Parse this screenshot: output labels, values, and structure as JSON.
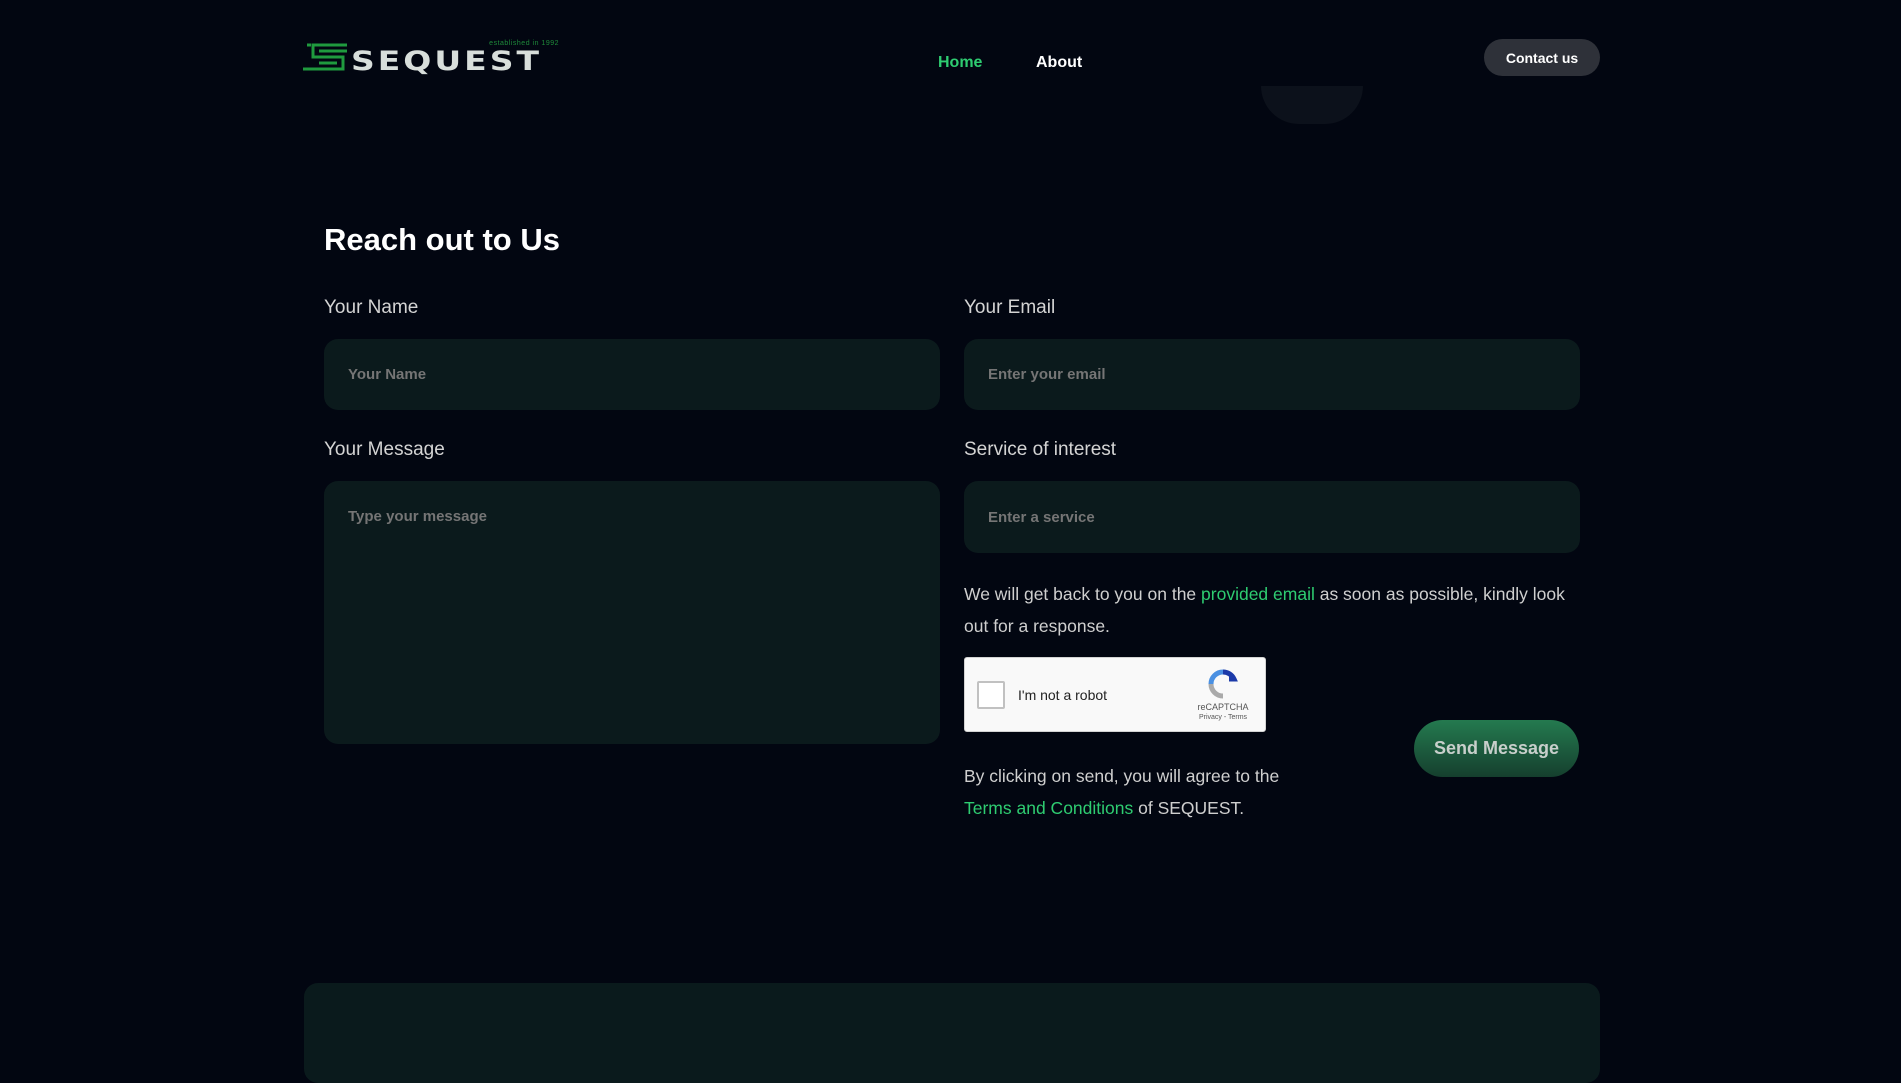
{
  "header": {
    "logo_text": "SEQUEST",
    "logo_tagline": "established in 1992",
    "nav": [
      {
        "label": "Home"
      },
      {
        "label": "About"
      }
    ],
    "contact_label": "Contact us"
  },
  "form": {
    "title": "Reach out to Us",
    "name_label": "Your Name",
    "name_placeholder": "Your Name",
    "email_label": "Your Email",
    "email_placeholder": "Enter your email",
    "message_label": "Your Message",
    "message_placeholder": "Type your message",
    "service_label": "Service of interest",
    "service_placeholder": "Enter a service",
    "note_before": "We will get back to you on the ",
    "note_link": "provided email",
    "note_after": " as soon as possible, kindly look out for a response.",
    "captcha": {
      "label": "I'm not a robot",
      "brand": "reCAPTCHA",
      "links": "Privacy - Terms"
    },
    "send_label": "Send Message",
    "agree_before": "By clicking on send, you will agree to the",
    "agree_link": "Terms and Conditions",
    "agree_after": " of SEQUEST."
  },
  "colors": {
    "accent": "#2ecc71",
    "background": "#020611",
    "field": "#0b1a1c"
  }
}
